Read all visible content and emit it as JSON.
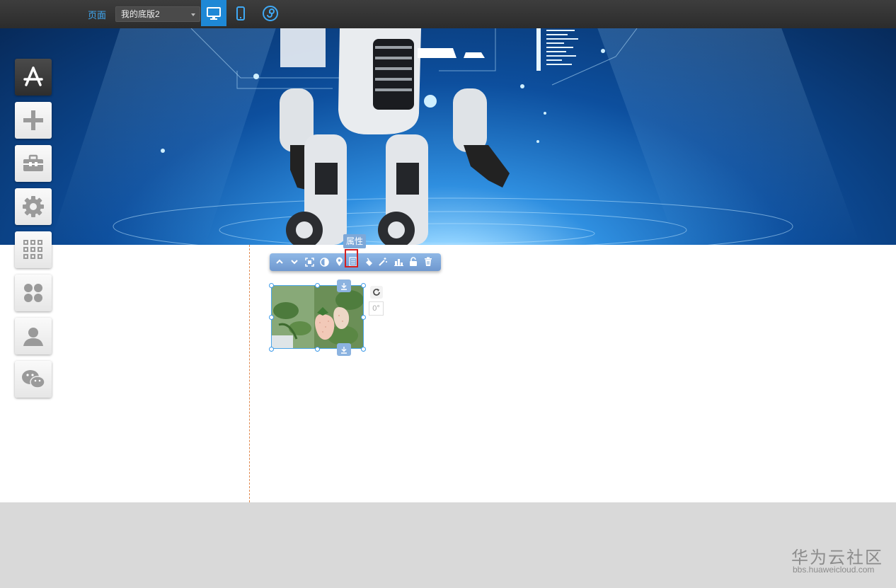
{
  "topbar": {
    "page_label": "页面",
    "page_select_value": "我的底版2",
    "view_buttons": [
      {
        "name": "desktop-view",
        "icon": "monitor-icon",
        "active": true
      },
      {
        "name": "mobile-view",
        "icon": "phone-icon",
        "active": false
      },
      {
        "name": "mini-program-view",
        "icon": "mini-program-icon",
        "active": false
      }
    ]
  },
  "sidebar": {
    "items": [
      {
        "icon": "app-store-icon",
        "active": true
      },
      {
        "icon": "plus-icon"
      },
      {
        "icon": "toolbox-icon"
      },
      {
        "icon": "gear-icon"
      },
      {
        "icon": "grid-apps-icon"
      },
      {
        "icon": "clover-icon"
      },
      {
        "icon": "user-icon"
      },
      {
        "icon": "wechat-icon"
      }
    ]
  },
  "element_toolbar": {
    "tooltip": "属性",
    "icons": [
      "move-up-icon",
      "move-down-icon",
      "crop-icon",
      "contrast-icon",
      "location-pin-icon",
      "properties-icon",
      "paint-bucket-icon",
      "magic-wand-icon",
      "chart-bar-icon",
      "unlock-icon",
      "trash-icon"
    ],
    "highlighted": "properties-icon"
  },
  "image_element": {
    "rotation_value": "0°",
    "subject": "strawberries"
  },
  "watermark": {
    "main": "华为云社区",
    "sub": "bbs.huaweicloud.com"
  },
  "colors": {
    "accent": "#1e88d6",
    "highlight_box": "#d51e1e",
    "toolbar": "#7ea8d8",
    "guide_line": "#e08a50"
  }
}
